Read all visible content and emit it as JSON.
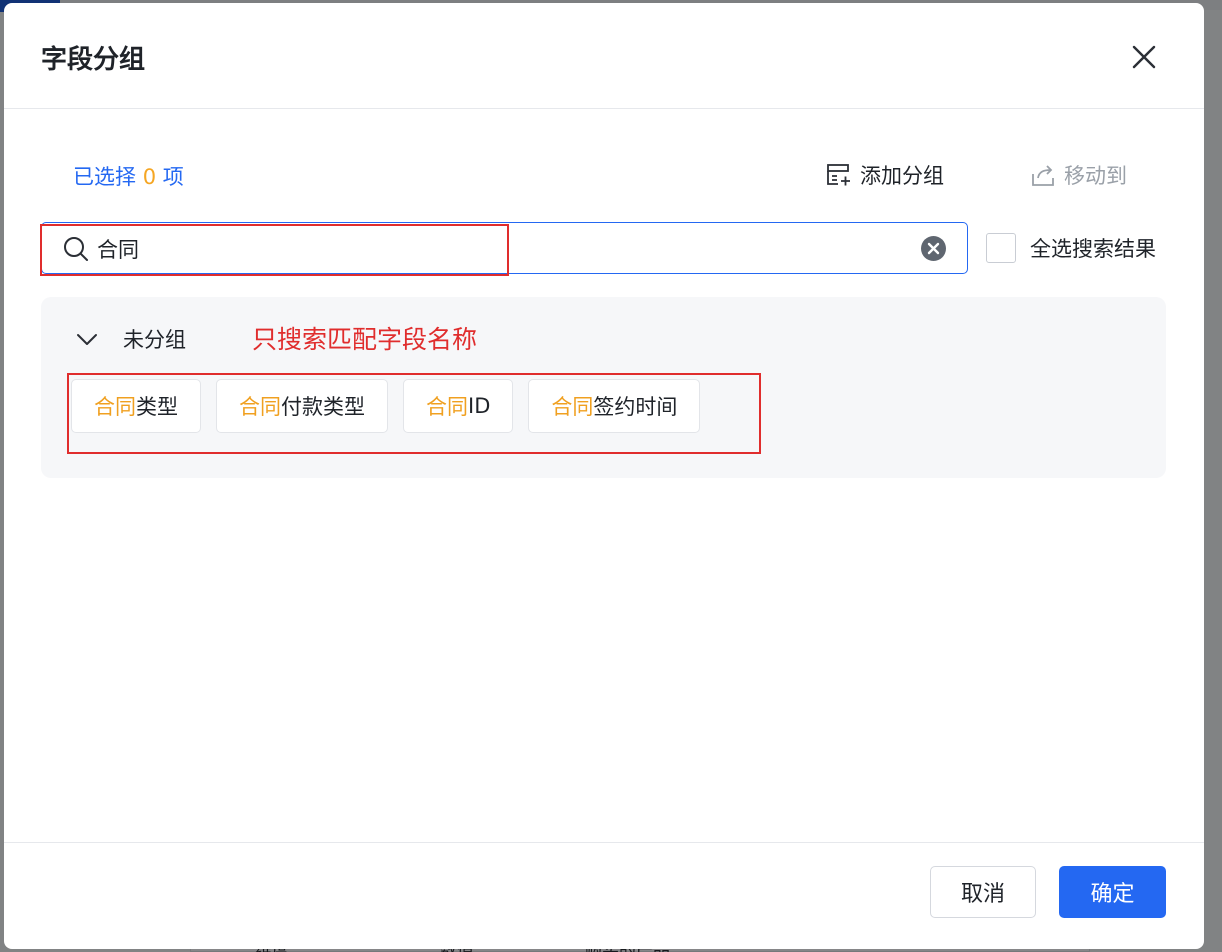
{
  "background": {
    "bottom_cells": [
      "维度",
      "数值",
      "购买的产品"
    ]
  },
  "dialog": {
    "title": "字段分组",
    "selected_prefix": "已选择",
    "selected_count": "0",
    "selected_suffix": "项",
    "add_group_label": "添加分组",
    "move_to_label": "移动到",
    "search": {
      "value": "合同",
      "placeholder": ""
    },
    "select_all_label": "全选搜索结果",
    "group": {
      "name": "未分组",
      "annotation": "只搜索匹配字段名称",
      "fields": [
        {
          "highlight": "合同",
          "rest": "类型"
        },
        {
          "highlight": "合同",
          "rest": "付款类型"
        },
        {
          "highlight": "合同",
          "rest": "ID"
        },
        {
          "highlight": "合同",
          "rest": "签约时间"
        }
      ]
    },
    "cancel_label": "取消",
    "ok_label": "确定"
  },
  "colors": {
    "accent": "#2468f2",
    "highlight": "#f0a020",
    "annotation": "#e02d2d"
  }
}
